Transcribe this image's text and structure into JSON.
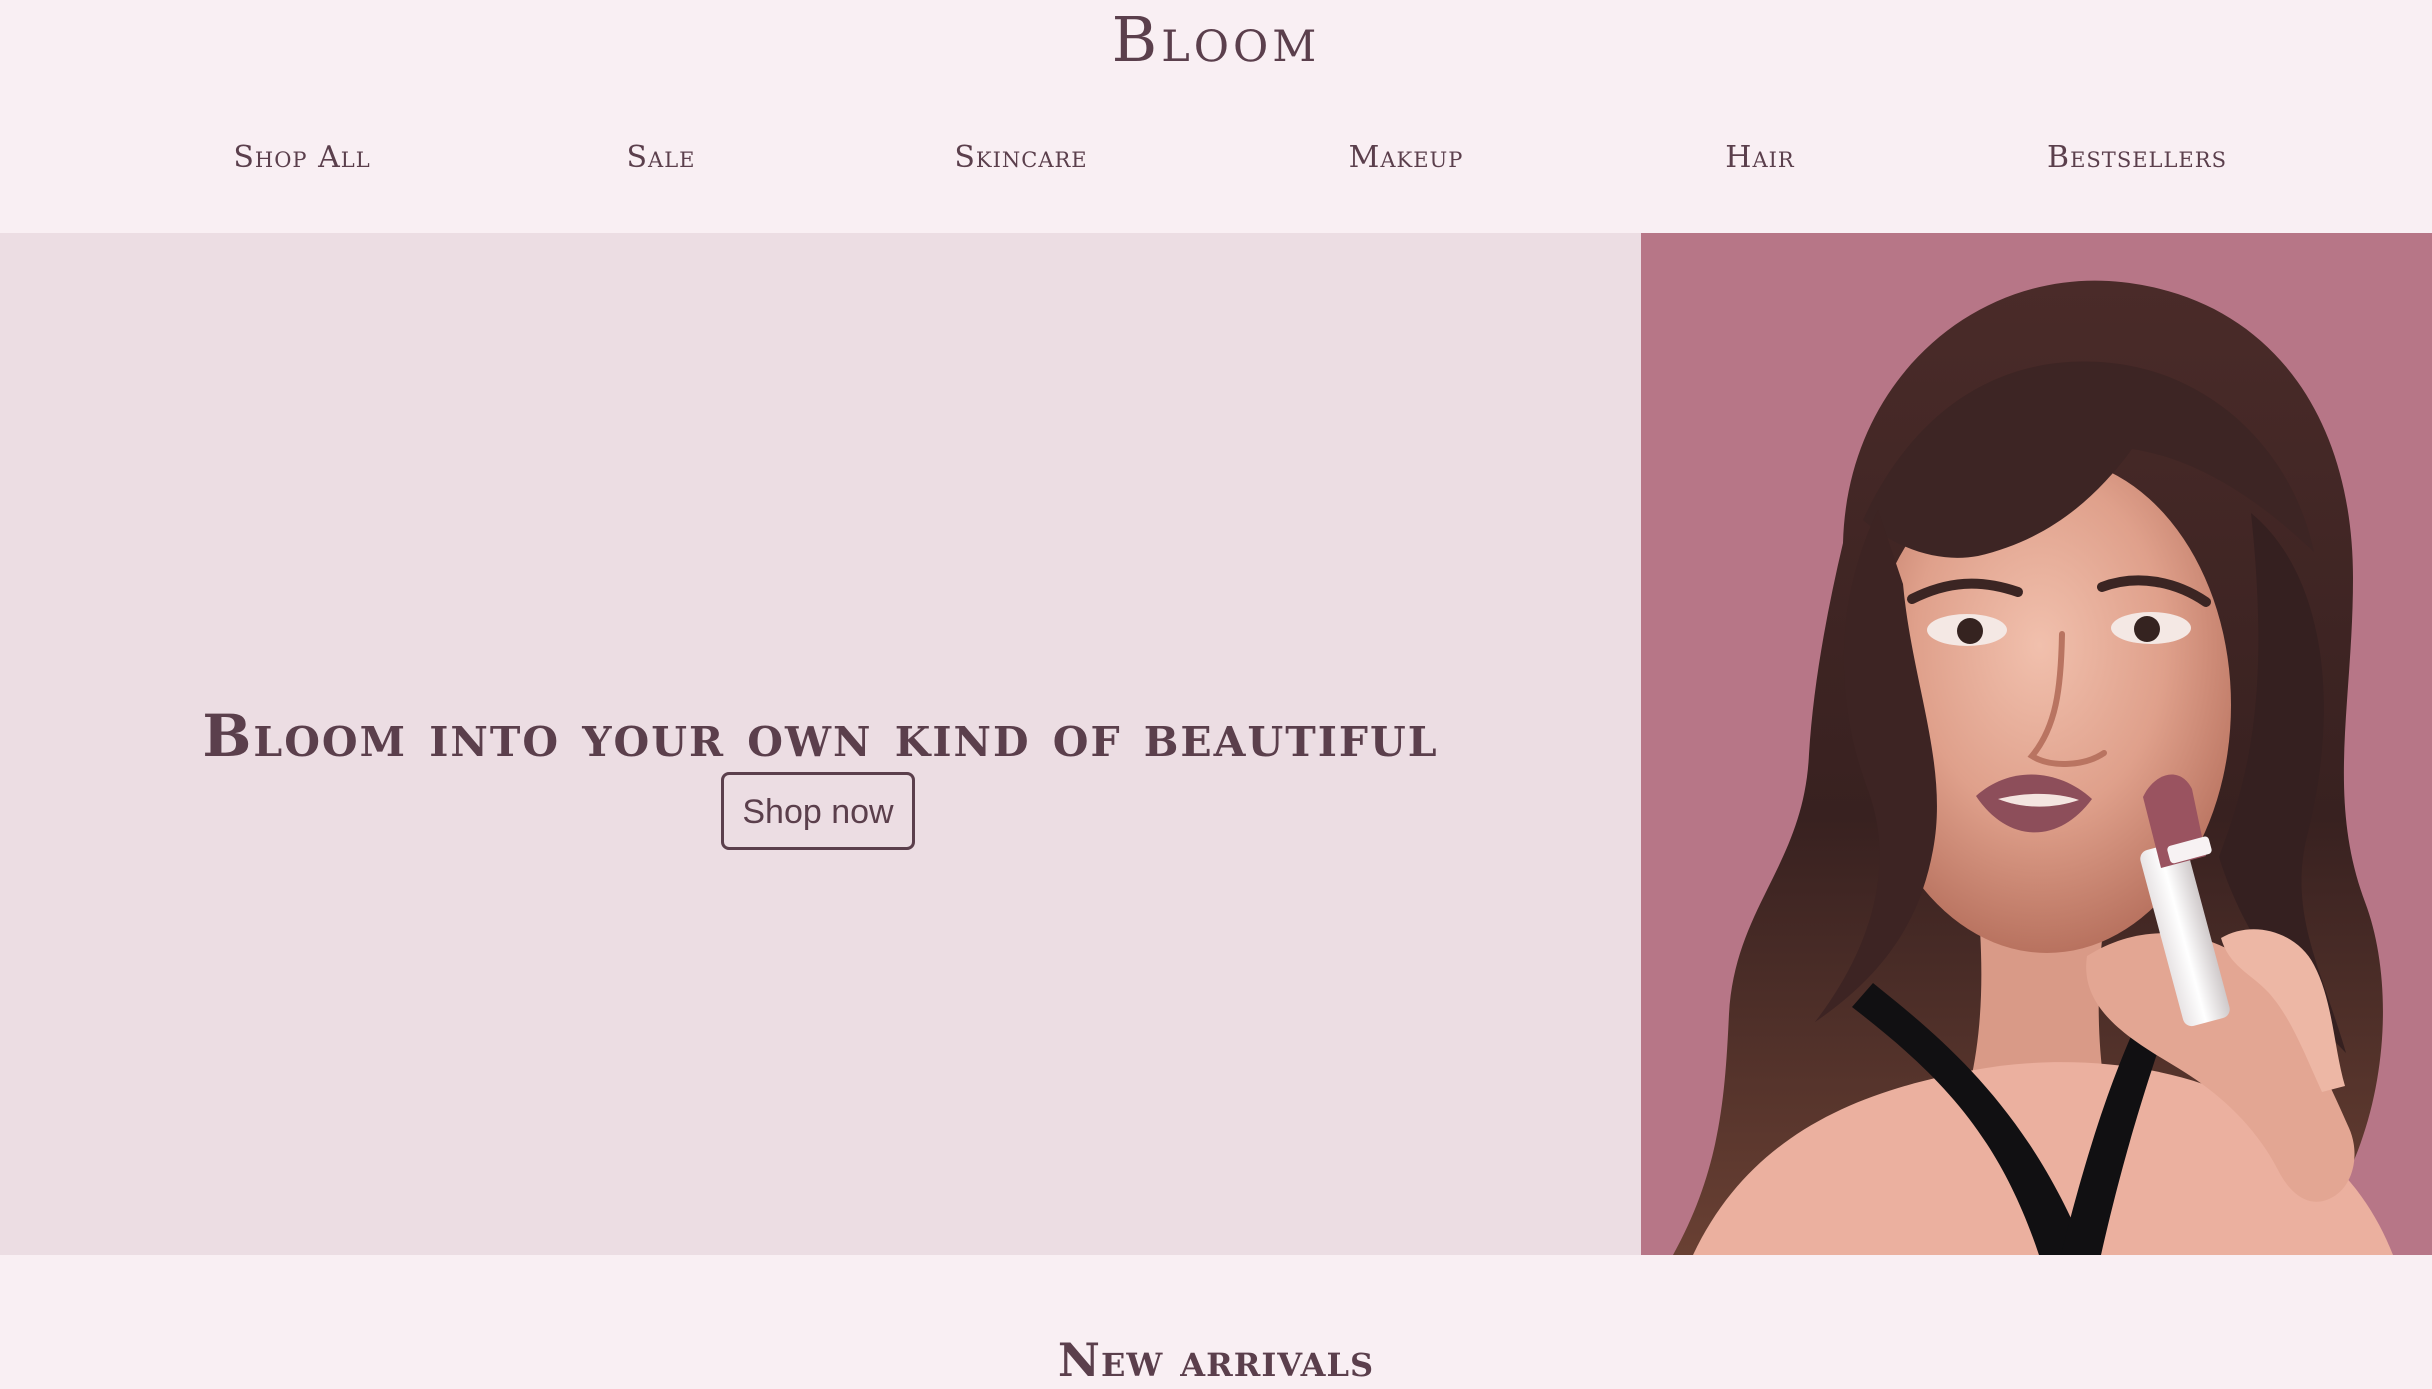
{
  "brand": {
    "name": "Bloom"
  },
  "navigation": {
    "items": [
      {
        "label": "Shop All"
      },
      {
        "label": "Sale"
      },
      {
        "label": "Skincare"
      },
      {
        "label": "Makeup"
      },
      {
        "label": "Hair"
      },
      {
        "label": "Bestsellers"
      }
    ]
  },
  "hero": {
    "headline": "Bloom into your own kind of beautiful",
    "cta_label": "Shop now",
    "image_subject": "model-applying-lipstick"
  },
  "new_arrivals": {
    "title": "New arrivals"
  },
  "colors": {
    "page_background": "#f9eff3",
    "hero_background": "#ecdde3",
    "text": "#5b3f4c",
    "image_background": "#b77687"
  }
}
